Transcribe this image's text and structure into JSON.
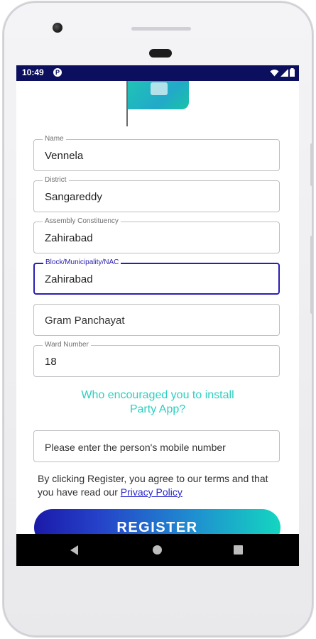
{
  "status_bar": {
    "time": "10:49",
    "app_icon": "P"
  },
  "icons": {
    "status_app": "p-circle-icon",
    "wifi": "wifi-icon",
    "signal": "signal-icon",
    "battery": "battery-icon",
    "nav_back": "back-triangle-icon",
    "nav_home": "home-circle-icon",
    "nav_recent": "recents-square-icon"
  },
  "colors": {
    "status_bar": "#0b0f5e",
    "focused_field": "#2a1fb0",
    "prompt_text": "#2ccfc0",
    "link": "#2a2ad0",
    "button_gradient_start": "#1a1aa8",
    "button_gradient_end": "#14d6c0"
  },
  "form": {
    "fields": [
      {
        "label": "Name",
        "value": "Vennela"
      },
      {
        "label": "District",
        "value": "Sangareddy"
      },
      {
        "label": "Assembly Constituency",
        "value": "Zahirabad"
      },
      {
        "label": "Block/Municipality/NAC",
        "value": "Zahirabad",
        "focused": true
      },
      {
        "label": "",
        "placeholder": "Gram Panchayat"
      },
      {
        "label": "Ward Number",
        "value": "18"
      }
    ],
    "prompt_line1": "Who encouraged you to install",
    "prompt_line2": "Party App?",
    "mobile_placeholder": "Please enter the person's mobile number",
    "terms_text": "By clicking Register, you agree to our terms and that you have read our ",
    "privacy_link": "Privacy Policy",
    "register_label": "REGISTER"
  }
}
